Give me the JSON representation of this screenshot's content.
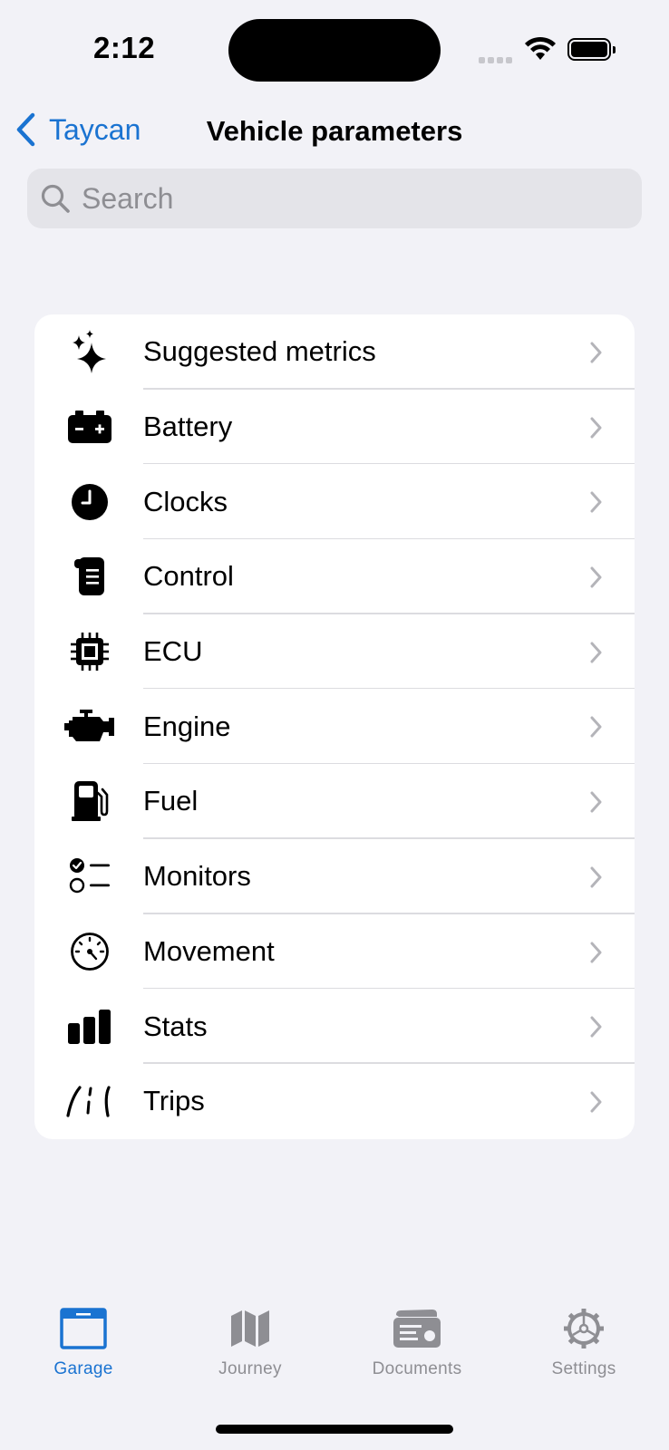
{
  "status": {
    "time": "2:12"
  },
  "nav": {
    "back_label": "Taycan",
    "title": "Vehicle parameters"
  },
  "search": {
    "placeholder": "Search",
    "value": ""
  },
  "list": {
    "items": [
      {
        "label": "Suggested metrics",
        "icon": "sparkles-icon"
      },
      {
        "label": "Battery",
        "icon": "battery-icon"
      },
      {
        "label": "Clocks",
        "icon": "clock-icon"
      },
      {
        "label": "Control",
        "icon": "control-scroll-icon"
      },
      {
        "label": "ECU",
        "icon": "cpu-chip-icon"
      },
      {
        "label": "Engine",
        "icon": "engine-icon"
      },
      {
        "label": "Fuel",
        "icon": "fuel-pump-icon"
      },
      {
        "label": "Monitors",
        "icon": "checklist-icon"
      },
      {
        "label": "Movement",
        "icon": "speedometer-icon"
      },
      {
        "label": "Stats",
        "icon": "bar-chart-icon"
      },
      {
        "label": "Trips",
        "icon": "road-icon"
      }
    ]
  },
  "tabbar": {
    "tabs": [
      {
        "label": "Garage",
        "icon": "garage-icon",
        "active": true
      },
      {
        "label": "Journey",
        "icon": "map-icon",
        "active": false
      },
      {
        "label": "Documents",
        "icon": "documents-icon",
        "active": false
      },
      {
        "label": "Settings",
        "icon": "gear-icon",
        "active": false
      }
    ]
  },
  "colors": {
    "accent": "#1a73d1",
    "background": "#f2f2f7",
    "inactive": "#8e8e93"
  }
}
